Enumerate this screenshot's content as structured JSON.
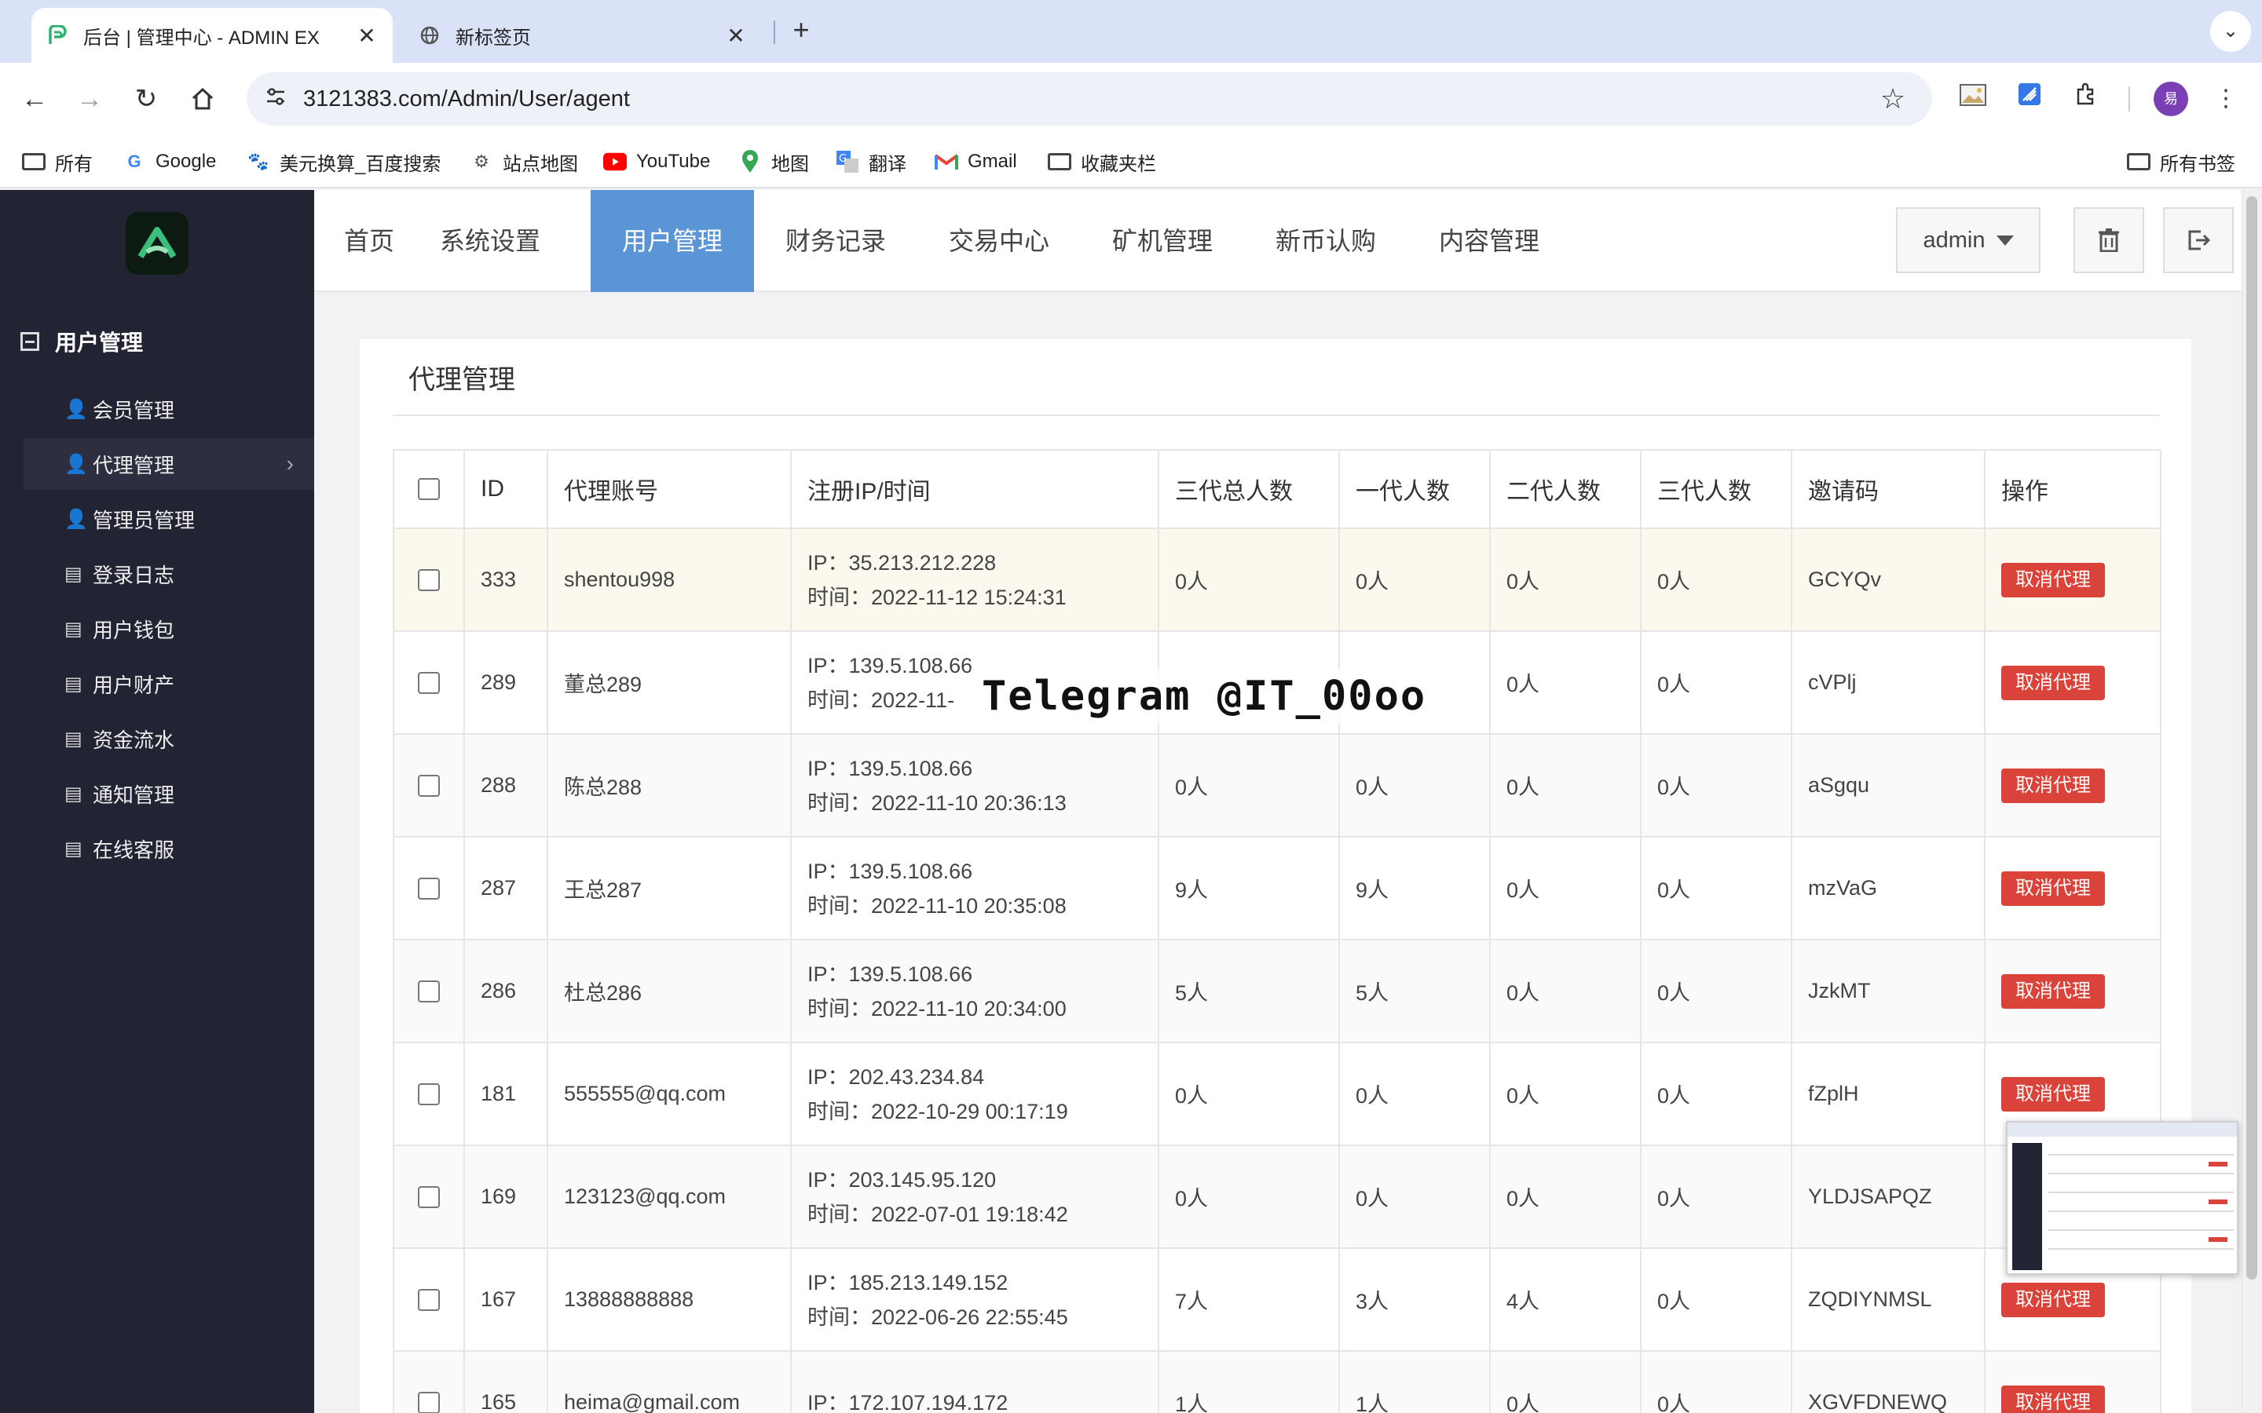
{
  "browser": {
    "tabs": [
      {
        "title": "后台 | 管理中心 - ADMIN EX",
        "active": true,
        "icon": "site-p-icon"
      },
      {
        "title": "新标签页",
        "active": false,
        "icon": "globe-icon"
      }
    ],
    "url": "3121383.com/Admin/User/agent",
    "profile_initial": "易",
    "bookmarks": [
      {
        "label": "所有",
        "icon": "folder-icon"
      },
      {
        "label": "Google",
        "icon": "google-icon"
      },
      {
        "label": "美元换算_百度搜索",
        "icon": "baidu-icon"
      },
      {
        "label": "站点地图",
        "icon": "sitemap-icon"
      },
      {
        "label": "YouTube",
        "icon": "youtube-icon"
      },
      {
        "label": "地图",
        "icon": "maps-icon"
      },
      {
        "label": "翻译",
        "icon": "translate-icon"
      },
      {
        "label": "Gmail",
        "icon": "gmail-icon"
      },
      {
        "label": "收藏夹栏",
        "icon": "folder-icon"
      }
    ],
    "all_bookmarks": "所有书签"
  },
  "sidebar": {
    "group_title": "用户管理",
    "items": [
      {
        "label": "会员管理",
        "icon": "user-icon",
        "active": false
      },
      {
        "label": "代理管理",
        "icon": "user-icon",
        "active": true
      },
      {
        "label": "管理员管理",
        "icon": "user-icon",
        "active": false
      },
      {
        "label": "登录日志",
        "icon": "list-icon",
        "active": false
      },
      {
        "label": "用户钱包",
        "icon": "list-icon",
        "active": false
      },
      {
        "label": "用户财产",
        "icon": "list-icon",
        "active": false
      },
      {
        "label": "资金流水",
        "icon": "list-icon",
        "active": false
      },
      {
        "label": "通知管理",
        "icon": "list-icon",
        "active": false
      },
      {
        "label": "在线客服",
        "icon": "list-icon",
        "active": false
      }
    ]
  },
  "topnav": {
    "items": [
      "首页",
      "系统设置",
      "用户管理",
      "财务记录",
      "交易中心",
      "矿机管理",
      "新币认购",
      "内容管理"
    ],
    "active_index": 2,
    "user": "admin"
  },
  "page": {
    "title": "代理管理",
    "columns": [
      "ID",
      "代理账号",
      "注册IP/时间",
      "三代总人数",
      "一代人数",
      "二代人数",
      "三代人数",
      "邀请码",
      "操作"
    ],
    "rows": [
      {
        "id": "333",
        "account": "shentou998",
        "ip": "IP：35.213.212.228",
        "time": "时间：2022-11-12 15:24:31",
        "total": "0人",
        "g1": "0人",
        "g2": "0人",
        "g3": "0人",
        "code": "GCYQv",
        "action": "取消代理"
      },
      {
        "id": "289",
        "account": "董总289",
        "ip": "IP：139.5.108.66",
        "time": "时间：2022-11-",
        "total": "",
        "g1": "",
        "g2": "0人",
        "g3": "0人",
        "code": "cVPlj",
        "action": "取消代理"
      },
      {
        "id": "288",
        "account": "陈总288",
        "ip": "IP：139.5.108.66",
        "time": "时间：2022-11-10 20:36:13",
        "total": "0人",
        "g1": "0人",
        "g2": "0人",
        "g3": "0人",
        "code": "aSgqu",
        "action": "取消代理"
      },
      {
        "id": "287",
        "account": "王总287",
        "ip": "IP：139.5.108.66",
        "time": "时间：2022-11-10 20:35:08",
        "total": "9人",
        "g1": "9人",
        "g2": "0人",
        "g3": "0人",
        "code": "mzVaG",
        "action": "取消代理"
      },
      {
        "id": "286",
        "account": "杜总286",
        "ip": "IP：139.5.108.66",
        "time": "时间：2022-11-10 20:34:00",
        "total": "5人",
        "g1": "5人",
        "g2": "0人",
        "g3": "0人",
        "code": "JzkMT",
        "action": "取消代理"
      },
      {
        "id": "181",
        "account": "555555@qq.com",
        "ip": "IP：202.43.234.84",
        "time": "时间：2022-10-29 00:17:19",
        "total": "0人",
        "g1": "0人",
        "g2": "0人",
        "g3": "0人",
        "code": "fZplH",
        "action": "取消代理"
      },
      {
        "id": "169",
        "account": "123123@qq.com",
        "ip": "IP：203.145.95.120",
        "time": "时间：2022-07-01 19:18:42",
        "total": "0人",
        "g1": "0人",
        "g2": "0人",
        "g3": "0人",
        "code": "YLDJSAPQZ",
        "action": ""
      },
      {
        "id": "167",
        "account": "13888888888",
        "ip": "IP：185.213.149.152",
        "time": "时间：2022-06-26 22:55:45",
        "total": "7人",
        "g1": "3人",
        "g2": "4人",
        "g3": "0人",
        "code": "ZQDIYNMSL",
        "action": "取消代理"
      },
      {
        "id": "165",
        "account": "heima@gmail.com",
        "ip": "IP：172.107.194.172",
        "time": "",
        "total": "1人",
        "g1": "1人",
        "g2": "0人",
        "g3": "0人",
        "code": "XGVFDNEWQ",
        "action": "取消代理"
      }
    ]
  },
  "overlay": {
    "watermark": "Telegram @IT_00oo"
  },
  "colors": {
    "sidebar_bg": "#222433",
    "nav_active": "#5b95d6",
    "danger": "#d9433a",
    "highlight_row": "#fbf9ee"
  }
}
